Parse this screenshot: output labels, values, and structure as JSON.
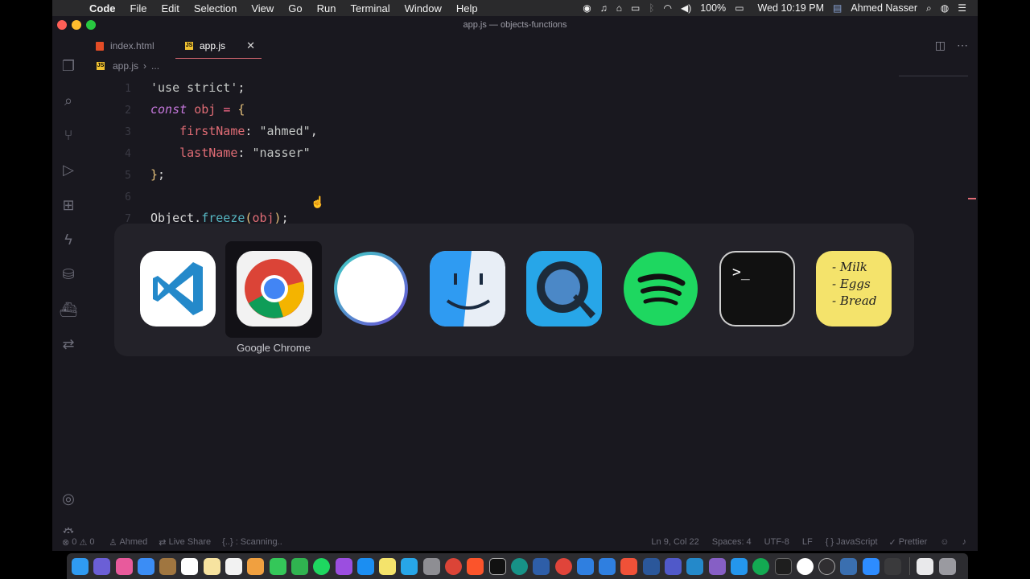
{
  "menubar": {
    "app_name": "Code",
    "items": [
      "File",
      "Edit",
      "Selection",
      "View",
      "Go",
      "Run",
      "Terminal",
      "Window",
      "Help"
    ],
    "battery": "100%",
    "datetime": "Wed 10:19 PM",
    "user": "Ahmed Nasser"
  },
  "window": {
    "title": "app.js — objects-functions"
  },
  "tabs": [
    {
      "label": "index.html"
    },
    {
      "label": "app.js"
    }
  ],
  "breadcrumb": {
    "file": "app.js",
    "rest": "..."
  },
  "editor": {
    "lines": [
      {
        "num": "1",
        "text": "'use strict';"
      },
      {
        "num": "2",
        "text": "const obj = {"
      },
      {
        "num": "3",
        "text": "firstName: \"ahmed\","
      },
      {
        "num": "4",
        "text": "lastName: \"nasser\""
      },
      {
        "num": "5",
        "text": "};"
      },
      {
        "num": "6",
        "text": ""
      },
      {
        "num": "7",
        "text": "Object.freeze(obj);"
      }
    ]
  },
  "app_switcher": {
    "selected_label": "Google Chrome",
    "apps": [
      "Visual Studio Code",
      "Google Chrome",
      "Circle",
      "Finder",
      "QuickTime Player",
      "Spotify",
      "Terminal",
      "Stickies"
    ],
    "stickies_text": [
      "- Milk",
      "- Eggs",
      "- Bread"
    ]
  },
  "statusbar": {
    "errors": "0",
    "warnings": "0",
    "git_user": "Ahmed",
    "live_share": "Live Share",
    "scanning": "{..} : Scanning..",
    "position": "Ln 9, Col 22",
    "spaces": "Spaces: 4",
    "encoding": "UTF-8",
    "eol": "LF",
    "language": "JavaScript",
    "formatter": "Prettier"
  },
  "colors": {
    "accent": "#e06c75",
    "editor_bg": "#19181f"
  }
}
